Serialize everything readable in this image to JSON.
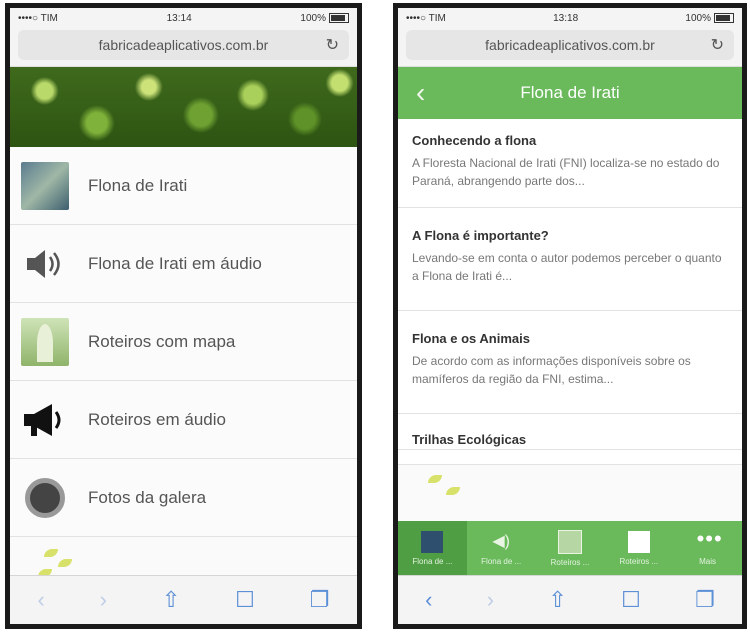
{
  "left": {
    "status": {
      "carrier": "••••○ TIM",
      "time": "13:14",
      "battery": "100%"
    },
    "url": "fabricadeaplicativos.com.br",
    "menu": [
      {
        "label": "Flona de Irati",
        "icon": "forest-map-thumbnail"
      },
      {
        "label": "Flona de Irati em áudio",
        "icon": "speaker-icon"
      },
      {
        "label": "Roteiros com mapa",
        "icon": "trail-map-thumbnail"
      },
      {
        "label": "Roteiros em áudio",
        "icon": "megaphone-icon"
      },
      {
        "label": "Fotos da galera",
        "icon": "camera-lens-icon"
      }
    ]
  },
  "right": {
    "status": {
      "carrier": "••••○ TIM",
      "time": "13:18",
      "battery": "100%"
    },
    "url": "fabricadeaplicativos.com.br",
    "header": {
      "back": "‹",
      "title": "Flona de Irati"
    },
    "articles": [
      {
        "title": "Conhecendo a flona",
        "excerpt": "A Floresta Nacional de Irati (FNI) localiza-se no estado do Paraná, abrangendo parte dos..."
      },
      {
        "title": "A Flona é importante?",
        "excerpt": "Levando-se em conta o autor podemos perceber o quanto a Flona de Irati é..."
      },
      {
        "title": "Flona e os Animais",
        "excerpt": "De acordo com as informações disponíveis sobre os mamíferos da região da FNI, estima..."
      },
      {
        "title": "Trilhas Ecológicas",
        "excerpt": ""
      }
    ],
    "tabs": [
      {
        "label": "Flona de ...",
        "icon": "book-icon"
      },
      {
        "label": "Flona de ...",
        "icon": "speaker-icon"
      },
      {
        "label": "Roteiros ...",
        "icon": "trail-icon"
      },
      {
        "label": "Roteiros ...",
        "icon": "megaphone-icon"
      },
      {
        "label": "Mais",
        "icon": "more-icon"
      }
    ]
  },
  "colors": {
    "app_green": "#6aba5c",
    "ios_blue": "#5b8fd6"
  }
}
